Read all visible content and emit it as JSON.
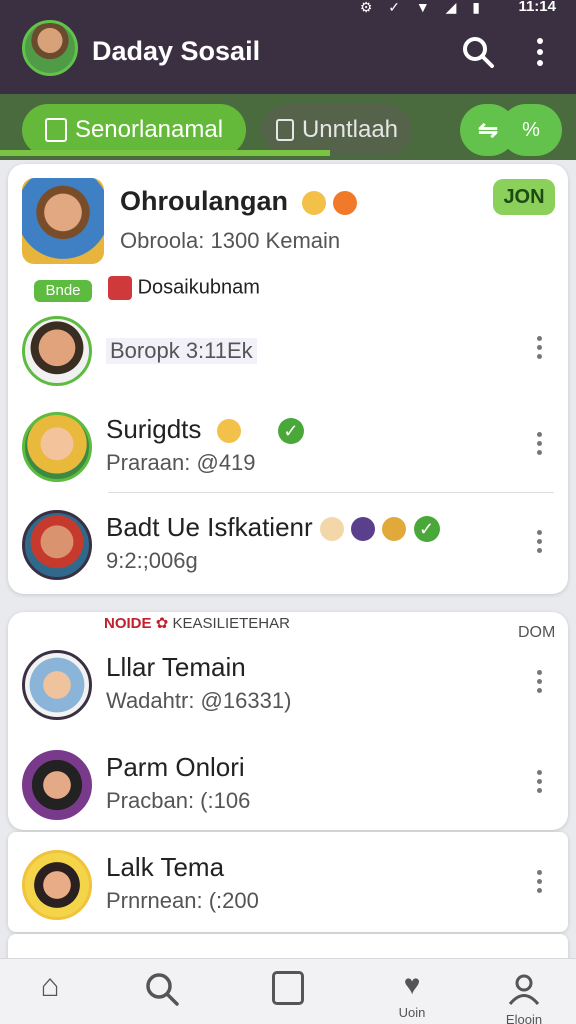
{
  "status_bar": {
    "time": "11:14"
  },
  "app_bar": {
    "title": "Daday Sosail",
    "search_icon": "search-icon",
    "more_icon": "more-vert-icon"
  },
  "tabs": [
    {
      "label": "Senorlanamal",
      "active": true
    },
    {
      "label": "Unntlaah",
      "active": false
    },
    {
      "label": "%",
      "active": false
    }
  ],
  "featured": {
    "title": "Ohroulangan",
    "subtitle": "Obroola: 1300 Kemain",
    "join_label": "JON",
    "tag_badge": "Bnde",
    "tag_label": "Dosaikubnam"
  },
  "chat_list_1": [
    {
      "title": "",
      "subtitle": "Boropk 3:11Ek"
    },
    {
      "title": "Surigdts",
      "subtitle": "Praraan: @419"
    },
    {
      "title": "Badt Ue Isfkatienr",
      "subtitle": "9:2:;006g"
    }
  ],
  "section2": {
    "header_red": "NOIDE",
    "header_text": "KEASILIETEHAR",
    "header_right": "DOM"
  },
  "chat_list_2": [
    {
      "title": "Lllar Temain",
      "subtitle": "Wadahtr: @16331)"
    },
    {
      "title": "Parm Onlori",
      "subtitle": "Pracban: (:106"
    }
  ],
  "chat_list_3": [
    {
      "title": "Lalk Tema",
      "subtitle": "Prnrnean: (:200"
    }
  ],
  "bottom_nav": [
    {
      "label": "",
      "icon": "home-icon"
    },
    {
      "label": "",
      "icon": "search-icon"
    },
    {
      "label": "",
      "icon": "doc-icon"
    },
    {
      "label": "Uoin",
      "icon": "heart-icon"
    },
    {
      "label": "Elooin",
      "icon": "person-icon"
    }
  ],
  "colors": {
    "appbar": "#3b3041",
    "accent_green": "#65b93a",
    "tabbar": "#4a6b3e"
  }
}
